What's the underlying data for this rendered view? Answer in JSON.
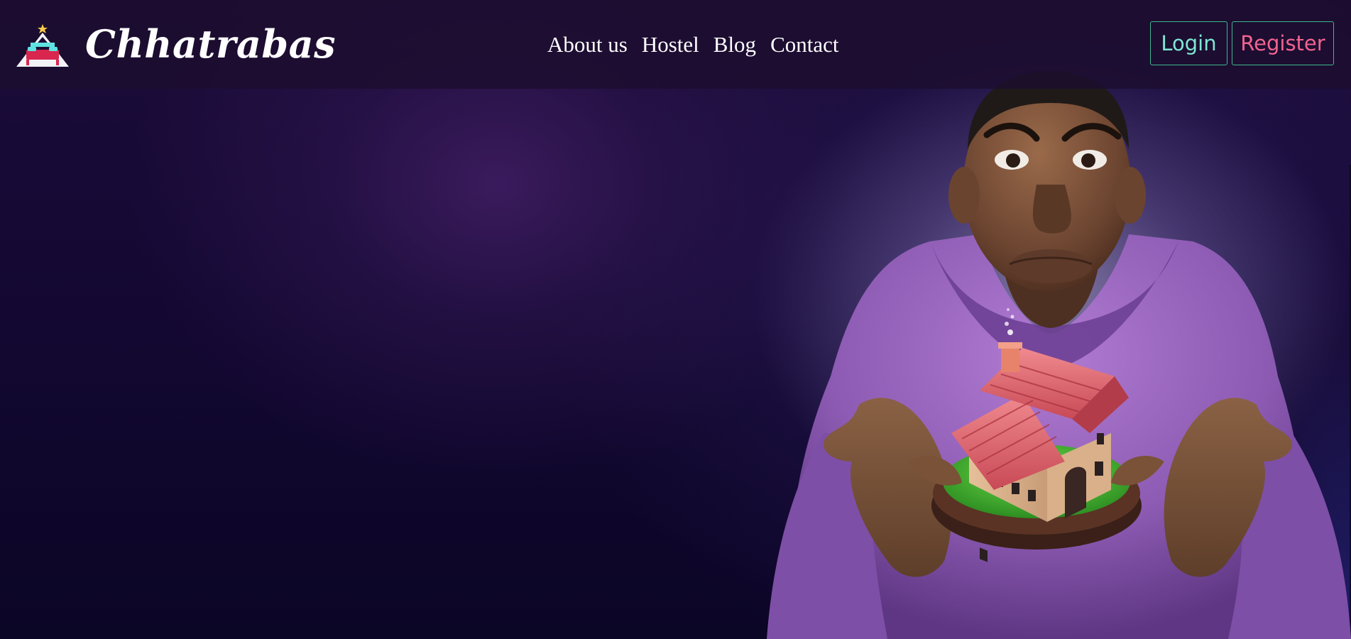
{
  "navbar": {
    "brand": "Chhatrabas",
    "links": [
      "About us",
      "Hostel",
      "Blog",
      "Contact"
    ],
    "login_label": "Login",
    "register_label": "Register"
  },
  "icons": {
    "logo": "bed-canopy-icon"
  },
  "hero": {
    "illustration": "character-holding-house"
  },
  "colors": {
    "background": "#0c0622",
    "navbar": "#1c0e2e",
    "login_text": "#7ee6d2",
    "register_text": "#f0648f",
    "button_border": "#3fb98e"
  }
}
